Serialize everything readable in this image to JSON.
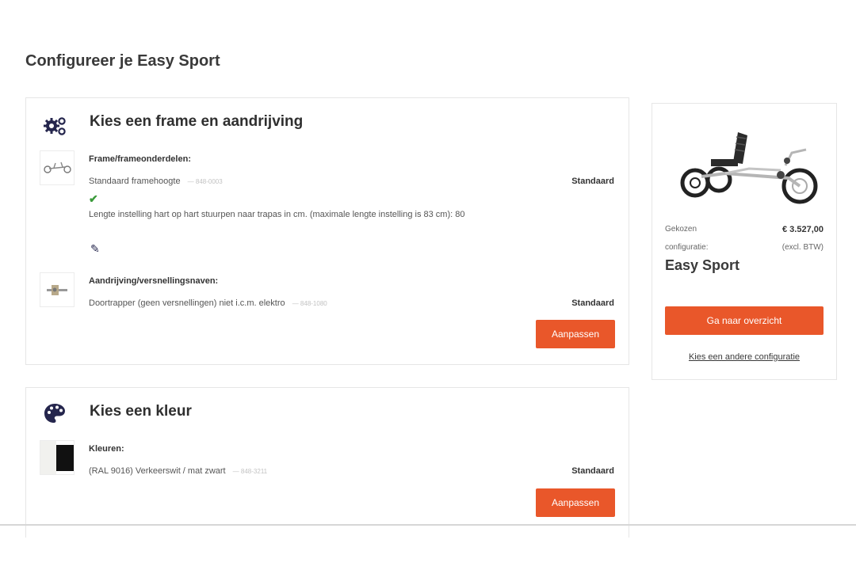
{
  "page": {
    "title": "Configureer je Easy Sport"
  },
  "sections": [
    {
      "title": "Kies een frame en aandrijving",
      "icon": "gears-icon",
      "options": [
        {
          "title": "Frame/frameonderdelen:",
          "value": "Standaard framehoogte",
          "code": "848-0003",
          "tag": "Standaard",
          "note": "Lengte instelling hart op hart stuurpen naar trapas in cm. (maximale lengte instelling is 83 cm): 80"
        },
        {
          "title": "Aandrijving/versnellingsnaven:",
          "value": "Doortrapper (geen versnellingen) niet i.c.m. elektro",
          "code": "848-1080",
          "tag": "Standaard"
        }
      ],
      "button": "Aanpassen"
    },
    {
      "title": "Kies een kleur",
      "icon": "palette-icon",
      "options": [
        {
          "title": "Kleuren:",
          "value": "(RAL 9016) Verkeerswit / mat zwart",
          "code": "848-3211",
          "tag": "Standaard"
        }
      ],
      "button": "Aanpassen"
    }
  ],
  "summary": {
    "chosen_label": "Gekozen",
    "config_label": "configuratie:",
    "price": "€ 3.527,00",
    "price_note": "(excl. BTW)",
    "model": "Easy Sport",
    "overview_button": "Ga naar overzicht",
    "other_config_link": "Kies een andere configuratie"
  },
  "colors": {
    "accent": "#e9572a",
    "icon": "#25264d",
    "check": "#3a9a3a"
  }
}
